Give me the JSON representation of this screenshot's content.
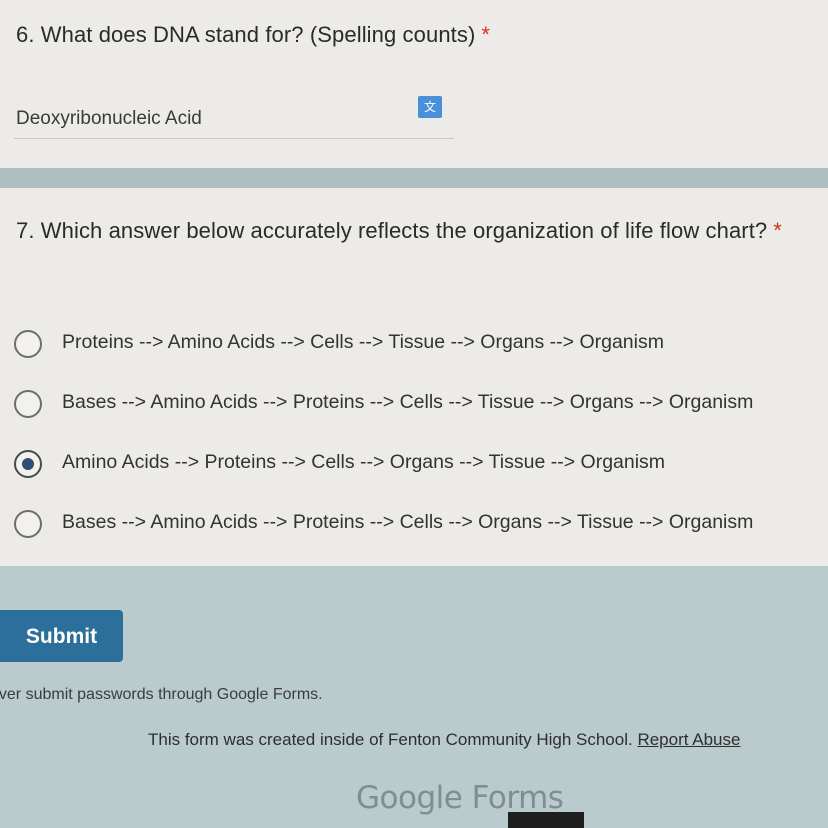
{
  "question6": {
    "title": "6. What does DNA stand for? (Spelling counts)",
    "required_mark": "*",
    "answer_value": "Deoxyribonucleic Acid",
    "translate_icon": "translate-icon"
  },
  "question7": {
    "title": "7. Which answer below accurately reflects the organization of life flow chart?",
    "required_mark": "*",
    "options": [
      {
        "label": "Proteins --> Amino Acids --> Cells --> Tissue --> Organs --> Organism",
        "selected": false
      },
      {
        "label": "Bases --> Amino Acids --> Proteins --> Cells --> Tissue --> Organs --> Organism",
        "selected": false
      },
      {
        "label": "Amino Acids --> Proteins --> Cells --> Organs --> Tissue --> Organism",
        "selected": true
      },
      {
        "label": "Bases --> Amino Acids --> Proteins --> Cells --> Organs --> Tissue --> Organism",
        "selected": false
      }
    ]
  },
  "submit_label": "Submit",
  "password_warning": "ever submit passwords through Google Forms.",
  "footer": {
    "created_text": "This form was created inside of Fenton Community High School.",
    "report_abuse": "Report Abuse"
  },
  "logo_text": "Google Forms",
  "colors": {
    "background": "#b9cbcd",
    "card": "#ecebe7",
    "submit": "#2c6f9a",
    "required": "#d93025"
  }
}
